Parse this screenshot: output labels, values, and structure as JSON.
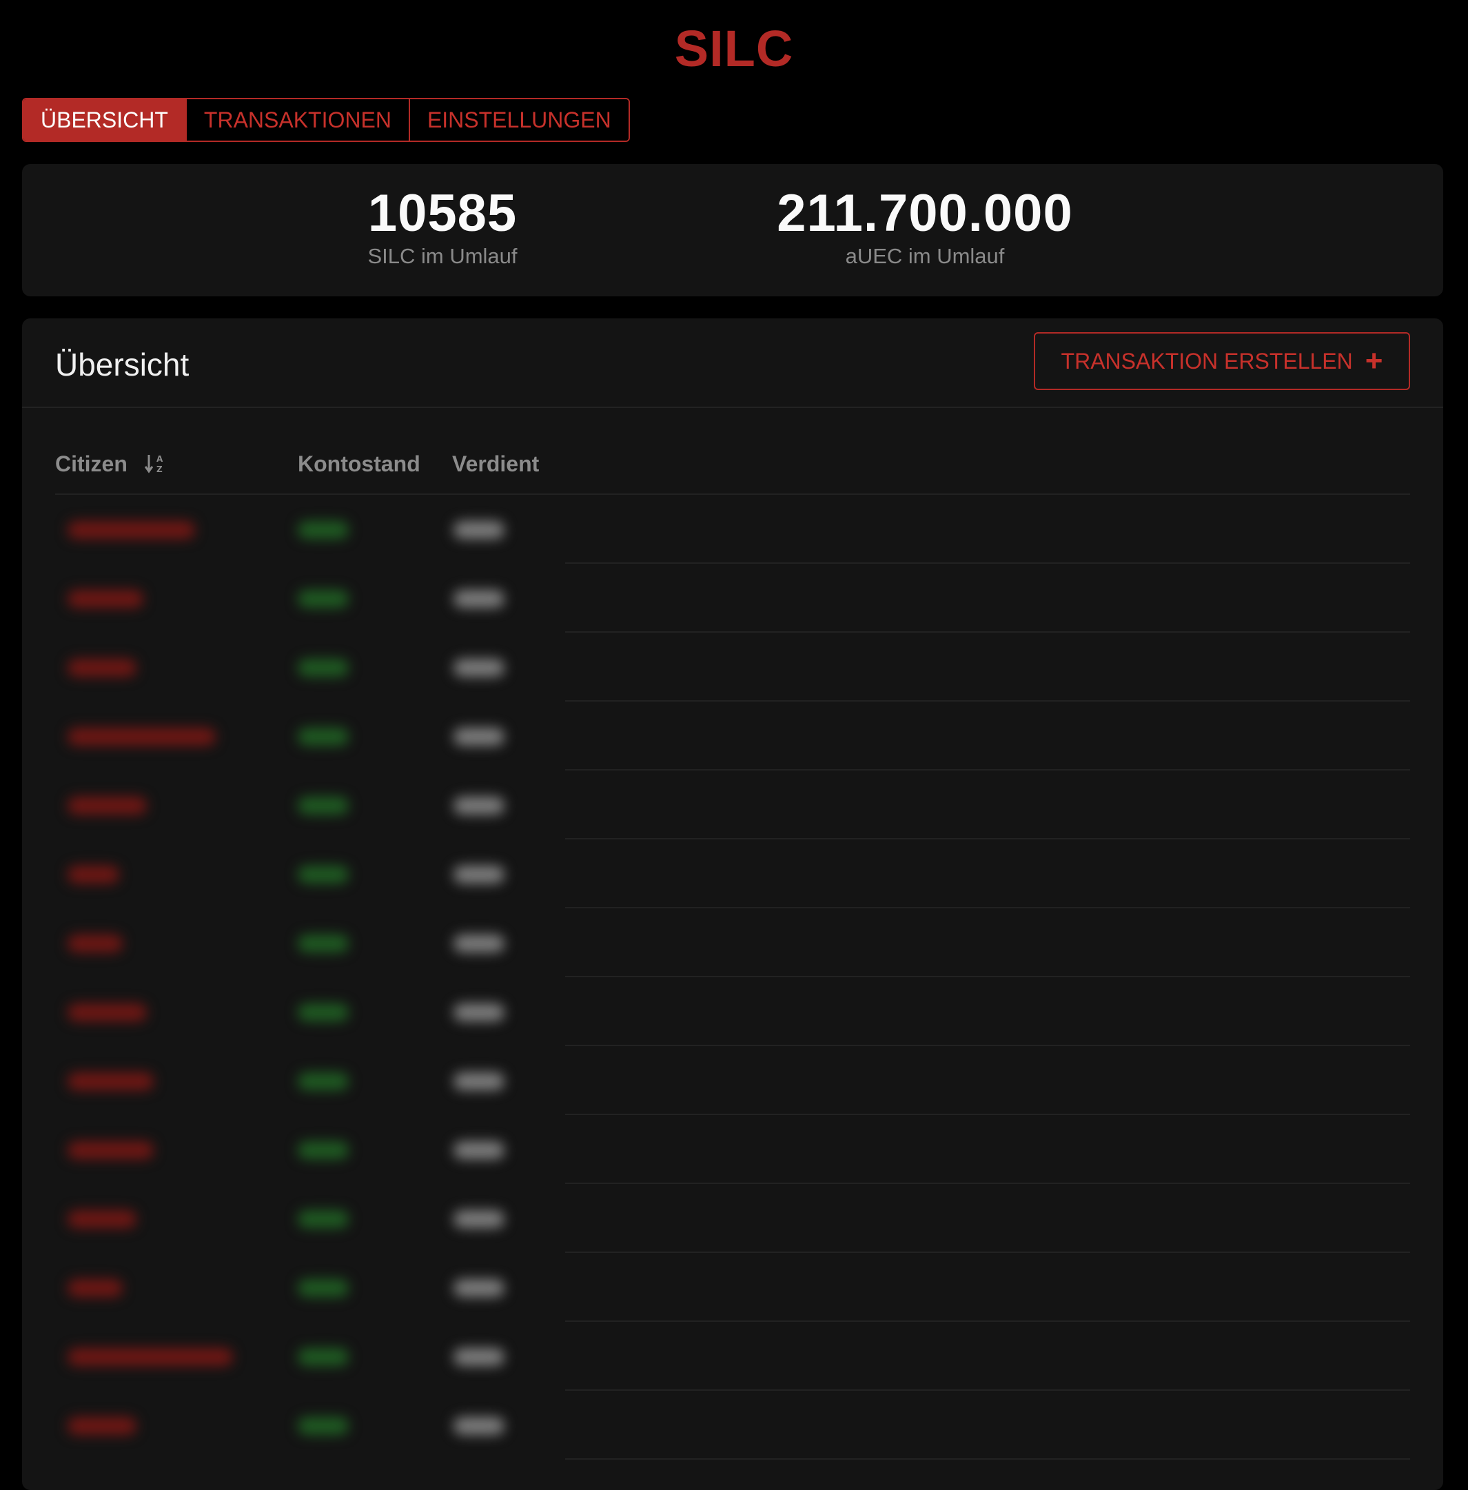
{
  "app": {
    "title": "SILC"
  },
  "tabs": [
    {
      "label": "ÜBERSICHT",
      "active": true
    },
    {
      "label": "TRANSAKTIONEN",
      "active": false
    },
    {
      "label": "EINSTELLUNGEN",
      "active": false
    }
  ],
  "stats": {
    "silc_value": "10585",
    "silc_label": "SILC im Umlauf",
    "auec_value": "211.700.000",
    "auec_label": "aUEC im Umlauf"
  },
  "overview": {
    "title": "Übersicht",
    "create_button_label": "TRANSAKTION ERSTELLEN",
    "create_button_icon": "plus-icon"
  },
  "table": {
    "columns": [
      "Citizen",
      "Kontostand",
      "Verdient"
    ],
    "sort_icon": "sort-alpha-down-icon",
    "row_count": 14,
    "rows_content": "blurred"
  },
  "colors": {
    "accent": "#b32a26",
    "background": "#000000",
    "card": "#141414",
    "blur_name": "#6e1714",
    "blur_balance": "#1f5a22",
    "blur_earned": "#7d7d7d"
  }
}
